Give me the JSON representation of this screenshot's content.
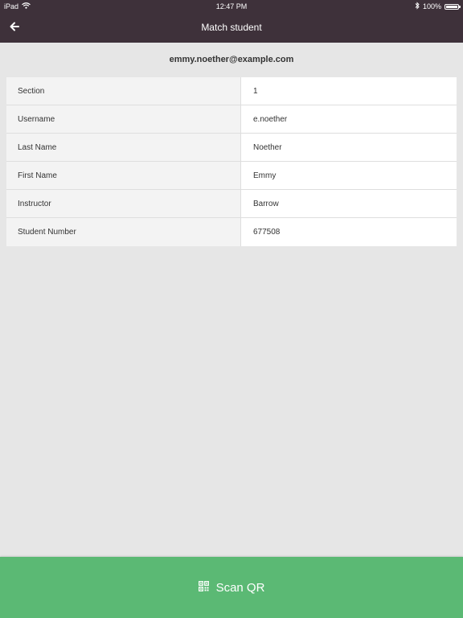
{
  "status_bar": {
    "device": "iPad",
    "time": "12:47 PM",
    "battery": "100%",
    "battery_level": 1.0,
    "icons": [
      "wifi-icon",
      "bluetooth-icon",
      "battery-icon"
    ]
  },
  "nav": {
    "back_icon": "arrow-left-icon",
    "title": "Match student"
  },
  "email": "emmy.noether@example.com",
  "student_fields": [
    {
      "label": "Section",
      "value": "1"
    },
    {
      "label": "Username",
      "value": "e.noether"
    },
    {
      "label": "Last Name",
      "value": "Noether"
    },
    {
      "label": "First Name",
      "value": "Emmy"
    },
    {
      "label": "Instructor",
      "value": "Barrow"
    },
    {
      "label": "Student Number",
      "value": "677508"
    }
  ],
  "scan_button": {
    "icon": "qr-code-icon",
    "label": "Scan QR"
  },
  "colors": {
    "header": "#3e313a",
    "background": "#e6e6e6",
    "accent_green": "#5bb974"
  }
}
